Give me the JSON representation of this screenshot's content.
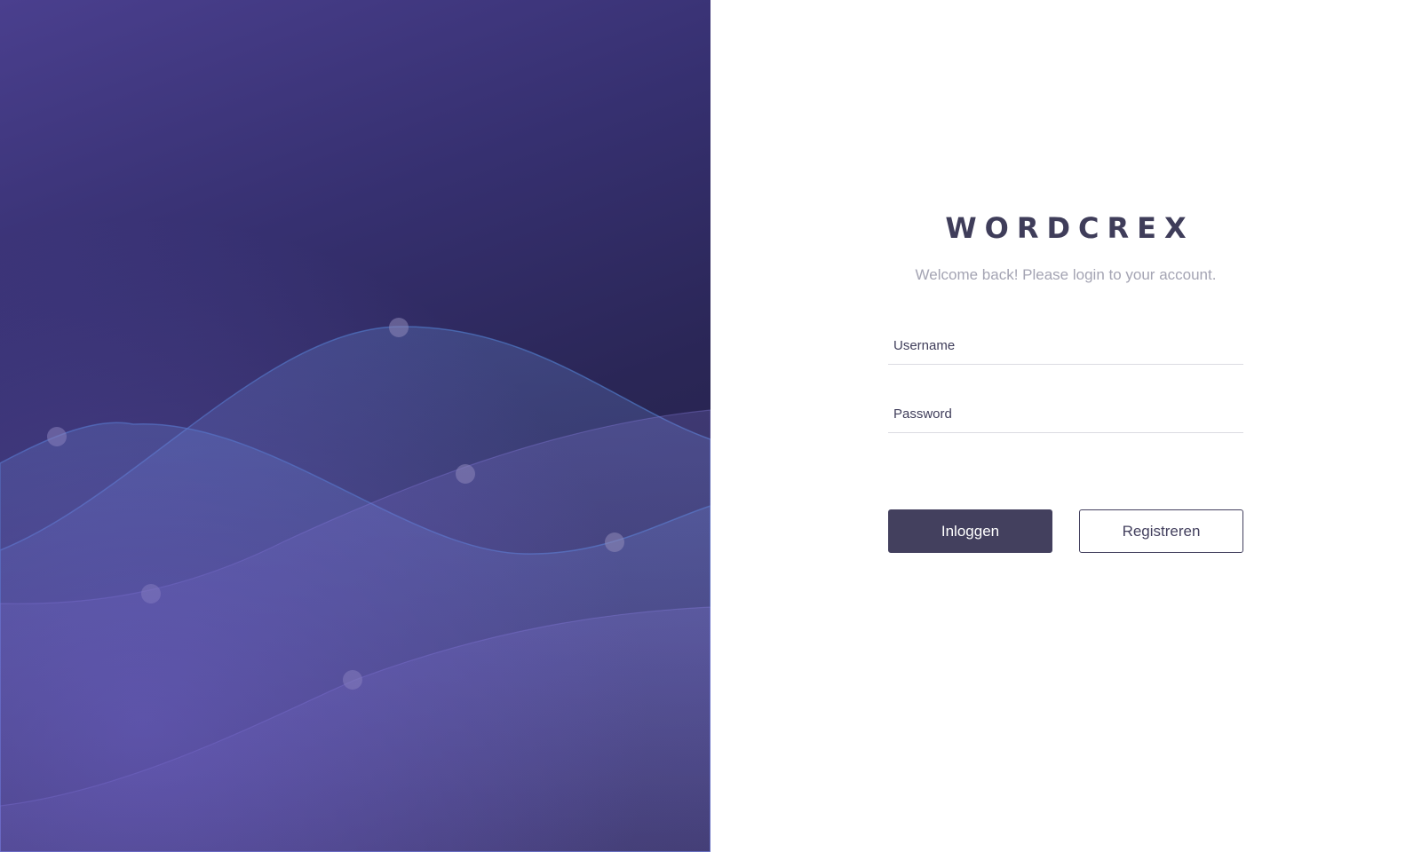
{
  "brand": {
    "name": "WORDCREX",
    "subtitle": "Welcome back! Please login to your account."
  },
  "form": {
    "username": {
      "value": "",
      "placeholder": "Username"
    },
    "password": {
      "value": "",
      "placeholder": "Password"
    },
    "login_label": "Inloggen",
    "register_label": "Registreren"
  },
  "colors": {
    "primary": "#43405e",
    "hero_dark": "#1f1d3d",
    "hero_light": "#5f55b0",
    "subtitle": "#a4a4b3"
  }
}
